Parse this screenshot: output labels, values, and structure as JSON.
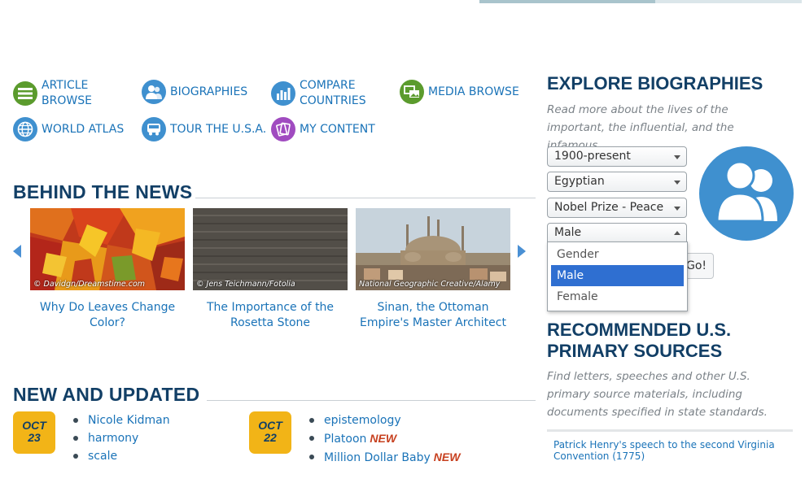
{
  "nav": {
    "article_browse": "ARTICLE\nBROWSE",
    "biographies": "BIOGRAPHIES",
    "compare_countries": "COMPARE\nCOUNTRIES",
    "media_browse": "MEDIA BROWSE",
    "world_atlas": "WORLD ATLAS",
    "tour_usa": "TOUR THE U.S.A.",
    "my_content": "MY CONTENT"
  },
  "behind_news": {
    "title": "BEHIND THE NEWS",
    "cards": [
      {
        "title": "Why Do Leaves Change Color?",
        "credit": "© Davidgn/Dreamstime.com"
      },
      {
        "title": "The Importance of the Rosetta Stone",
        "credit": "© Jens Teichmann/Fotolia"
      },
      {
        "title": "Sinan, the Ottoman Empire's Master Architect",
        "credit": "National Geographic Creative/Alamy"
      }
    ]
  },
  "new_updated": {
    "title": "NEW AND UPDATED",
    "groups": [
      {
        "month": "OCT",
        "day": "23",
        "items": [
          {
            "text": "Nicole Kidman",
            "tag": ""
          },
          {
            "text": "harmony",
            "tag": ""
          },
          {
            "text": "scale",
            "tag": ""
          }
        ]
      },
      {
        "month": "OCT",
        "day": "22",
        "items": [
          {
            "text": "epistemology",
            "tag": ""
          },
          {
            "text": "Platoon",
            "tag": "NEW"
          },
          {
            "text": "Million Dollar Baby",
            "tag": "NEW"
          }
        ]
      }
    ]
  },
  "explore": {
    "title": "EXPLORE BIOGRAPHIES",
    "description": "Read more about the lives of the important, the influential, and the infamous.",
    "selects": {
      "period": "1900-present",
      "nationality": "Egyptian",
      "award": "Nobel Prize - Peace",
      "gender": "Male"
    },
    "gender_options": [
      "Gender",
      "Male",
      "Female"
    ],
    "go_label": "Go!"
  },
  "primary_sources": {
    "title": "RECOMMENDED U.S. PRIMARY SOURCES",
    "description": "Find letters, speeches and other U.S. primary source materials, including documents specified in state standards.",
    "link": "Patrick Henry's speech to the second Virginia Convention (1775)"
  },
  "colors": {
    "heading": "#123f66",
    "link": "#1a73b8",
    "badge": "#f2b417",
    "new_tag": "#c7401f",
    "icon_blue": "#3f90cf",
    "icon_green": "#5b9b2d",
    "icon_purple": "#a04bc0"
  },
  "icons": {
    "article_browse": "list-icon",
    "biographies": "people-icon",
    "compare_countries": "bar-chart-icon",
    "media_browse": "images-icon",
    "world_atlas": "globe-icon",
    "tour_usa": "bus-icon",
    "my_content": "cards-icon"
  }
}
